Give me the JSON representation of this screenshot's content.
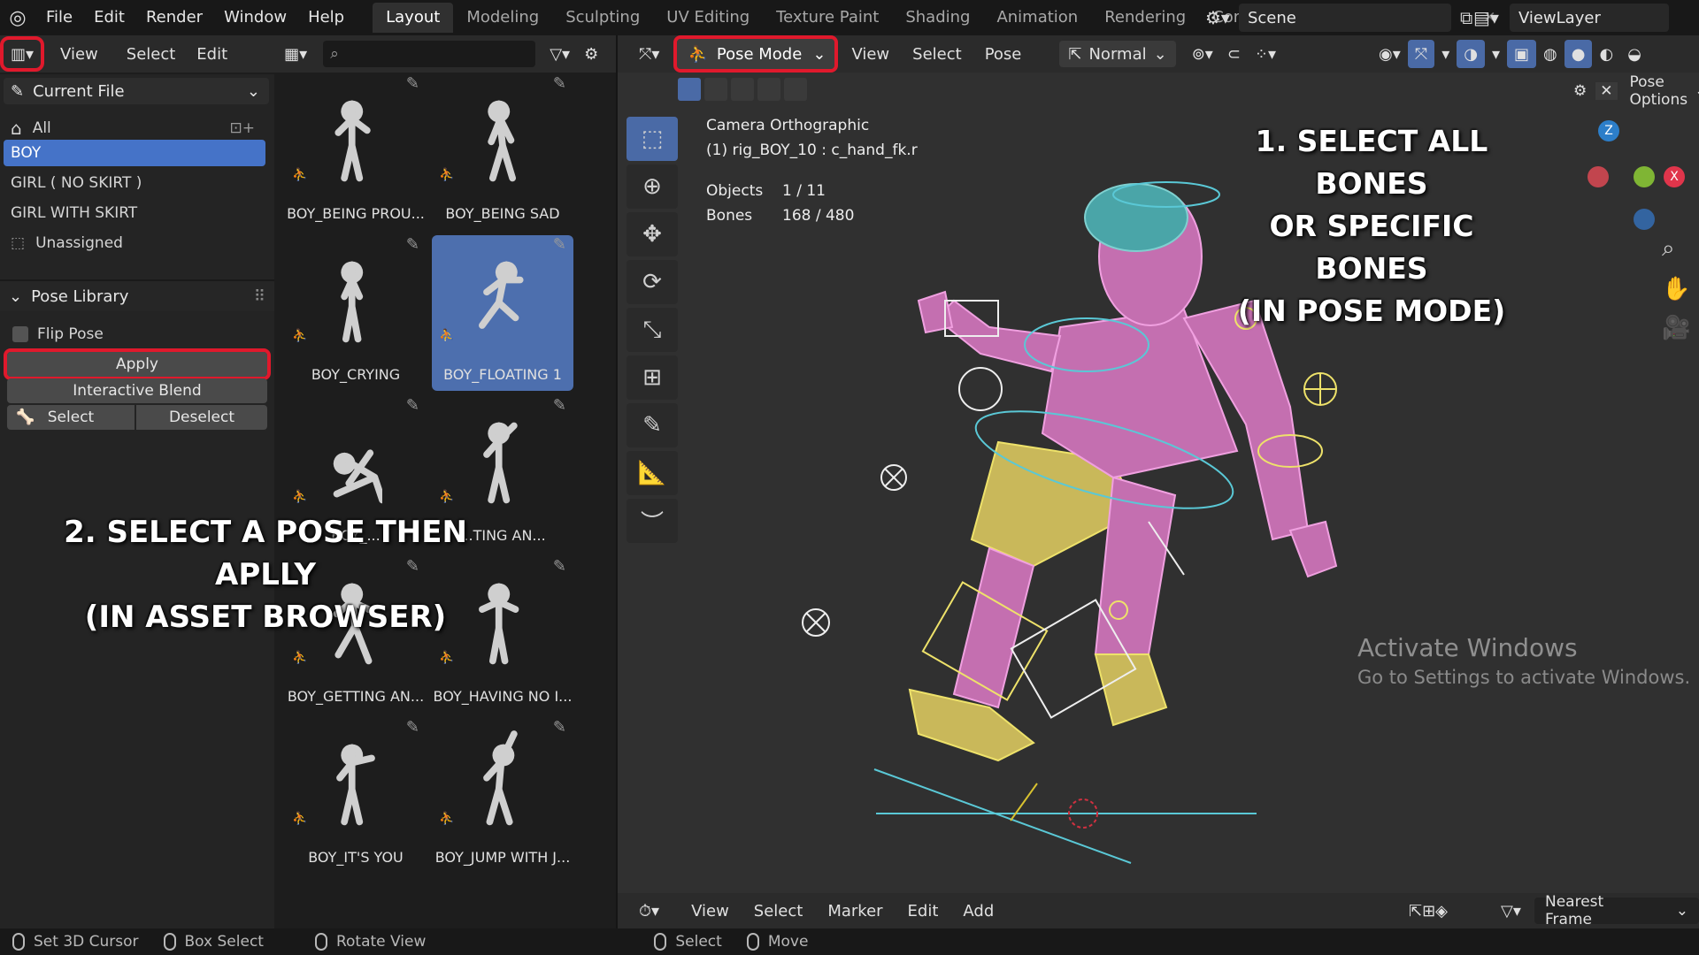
{
  "menubar": {
    "logo": "blender-logo-icon",
    "menus": [
      "File",
      "Edit",
      "Render",
      "Window",
      "Help"
    ],
    "workspaces": [
      "Layout",
      "Modeling",
      "Sculpting",
      "UV Editing",
      "Texture Paint",
      "Shading",
      "Animation",
      "Rendering",
      "Compo"
    ],
    "active_workspace": "Layout",
    "scene": "Scene",
    "view_layer": "ViewLayer"
  },
  "asset_browser": {
    "menus": [
      "View",
      "Select",
      "Edit"
    ],
    "library": "Current File",
    "categories": [
      "All",
      "BOY",
      "GIRL ( NO SKIRT )",
      "GIRL WITH SKIRT",
      "Unassigned"
    ],
    "selected_category": "BOY",
    "pose_library": {
      "title": "Pose Library",
      "flip_pose": "Flip Pose",
      "apply": "Apply",
      "interactive_blend": "Interactive Blend",
      "select": "Select",
      "deselect": "Deselect"
    },
    "assets": [
      {
        "label": "BOY_BEING PROU...",
        "selected": false
      },
      {
        "label": "BOY_BEING SAD",
        "selected": false
      },
      {
        "label": "BOY_CRYING",
        "selected": false
      },
      {
        "label": "BOY_FLOATING 1",
        "selected": true
      },
      {
        "label": "BOY_...",
        "selected": false
      },
      {
        "label": "...TING AN...",
        "selected": false
      },
      {
        "label": "BOY_GETTING AN...",
        "selected": false
      },
      {
        "label": "BOY_HAVING NO I...",
        "selected": false
      },
      {
        "label": "BOY_IT'S YOU",
        "selected": false
      },
      {
        "label": "BOY_JUMP WITH J...",
        "selected": false
      }
    ]
  },
  "annotations": {
    "step1": [
      "1. SELECT ALL BONES",
      "OR SPECIFIC BONES",
      "(IN POSE MODE)"
    ],
    "step2": [
      "2. SELECT A POSE THEN APLLY",
      "(IN ASSET BROWSER)"
    ]
  },
  "viewport": {
    "mode": "Pose Mode",
    "menus": [
      "View",
      "Select",
      "Pose"
    ],
    "orientation": "Normal",
    "view_name": "Camera Orthographic",
    "active": "(1) rig_BOY_10 : c_hand_fk.r",
    "objects_label": "Objects",
    "objects_value": "1 / 11",
    "bones_label": "Bones",
    "bones_value": "168 / 480",
    "pose_options": "Pose Options",
    "gizmo_axes": [
      "Z",
      "X"
    ],
    "watermark_title": "Activate Windows",
    "watermark_sub": "Go to Settings to activate Windows.",
    "colors": {
      "accent": "#4573c8",
      "highlight": "#e0192c",
      "x_axis": "#e0354b",
      "y_axis": "#7fb534",
      "z_axis": "#2c7ec9"
    }
  },
  "timeline": {
    "menus": [
      "View",
      "Select",
      "Marker",
      "Edit",
      "Add"
    ],
    "snap": "Nearest Frame"
  },
  "statusbar": [
    "Set 3D Cursor",
    "Box Select",
    "Rotate View",
    "Select",
    "Move"
  ]
}
